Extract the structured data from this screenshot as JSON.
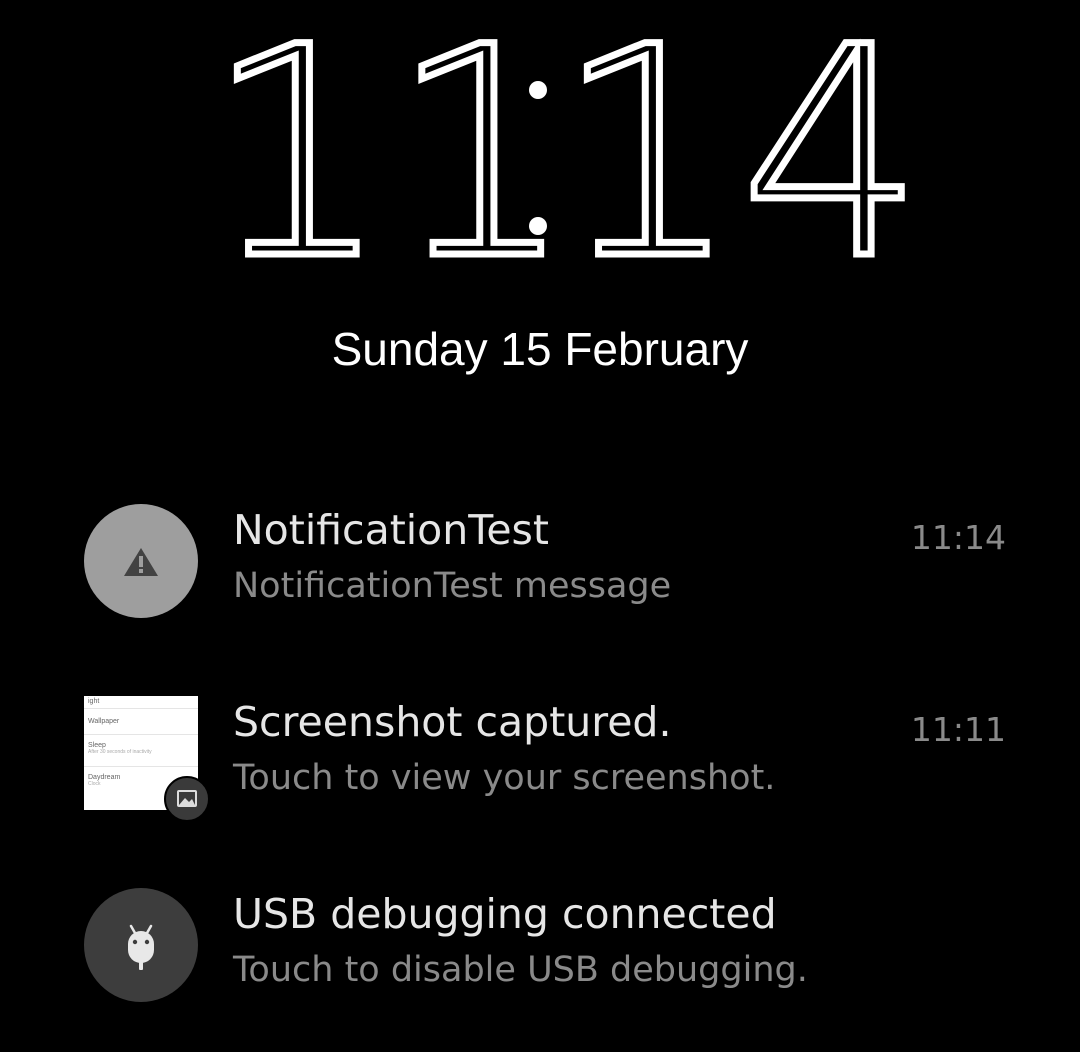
{
  "lockscreen": {
    "clock": {
      "hours": "11",
      "minutes": "14"
    },
    "date": "Sunday 15 February"
  },
  "notifications": [
    {
      "app": "NotificationTest",
      "icon": "warning-icon",
      "title": "NotificationTest",
      "body": "NotificationTest message",
      "time": "11:14",
      "icon_bg": "#9e9e9e"
    },
    {
      "app": "Screenshot",
      "icon": "image-icon",
      "title": "Screenshot captured.",
      "body": "Touch to view your screenshot.",
      "time": "11:11",
      "thumbnail": {
        "rows": [
          {
            "label": "ight",
            "sub": ""
          },
          {
            "label": "Wallpaper",
            "sub": ""
          },
          {
            "label": "Sleep",
            "sub": "After 30 seconds of inactivity"
          },
          {
            "label": "Daydream",
            "sub": "Clock"
          }
        ]
      }
    },
    {
      "app": "USB debugging",
      "icon": "android-icon",
      "title": "USB debugging connected",
      "body": "Touch to disable USB debugging.",
      "time": "",
      "icon_bg": "#3d3d3d"
    }
  ],
  "colors": {
    "background": "#000000",
    "title_text": "#e6e6e6",
    "secondary_text": "#8a8a8a"
  }
}
